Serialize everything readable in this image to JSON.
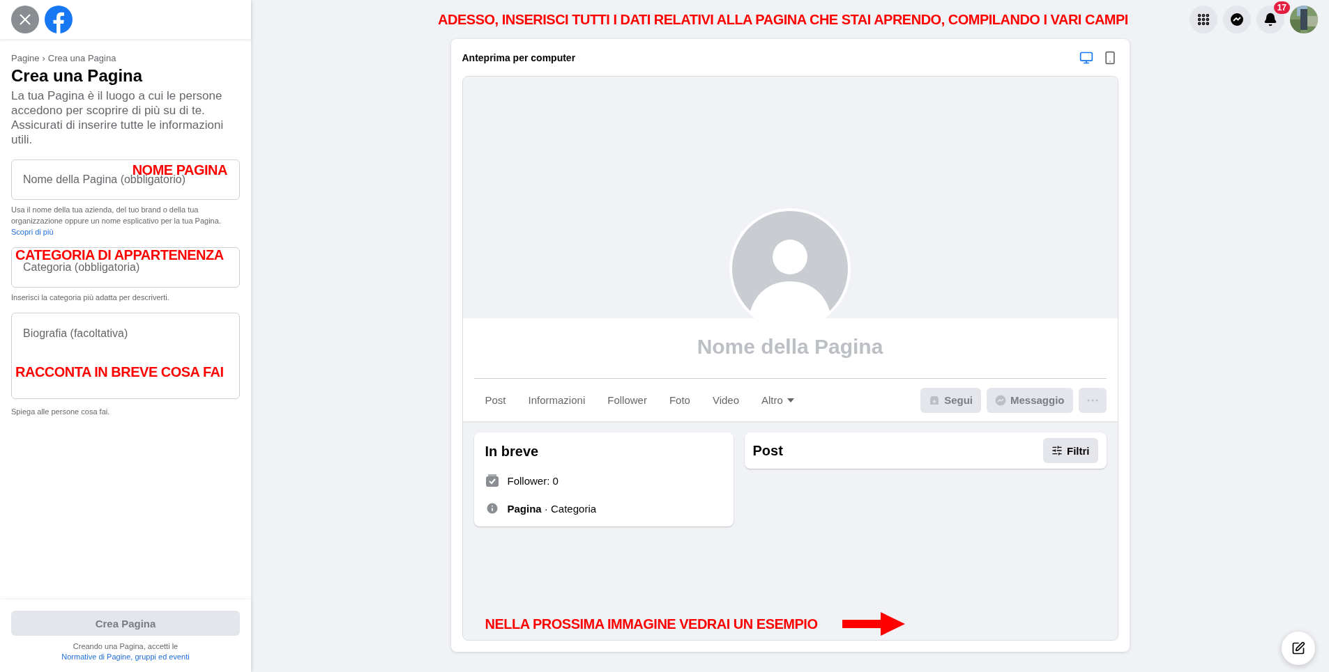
{
  "topbar": {
    "annotation": "ADESSO, INSERISCI TUTTI I DATI RELATIVI ALLA PAGINA CHE STAI APRENDO, COMPILANDO I VARI CAMPI",
    "notification_count": "17"
  },
  "sidebar": {
    "breadcrumb": [
      "Pagine",
      "Crea una Pagina"
    ],
    "breadcrumb_separator": "›",
    "title": "Crea una Pagina",
    "description": "La tua Pagina è il luogo a cui le persone accedono per scoprire di più su di te. Assicurati di inserire tutte le informazioni utili.",
    "fields": [
      {
        "kind": "input",
        "placeholder": "Nome della Pagina (obbligatorio)",
        "help": "Usa il nome della tua azienda, del tuo brand o della tua organizzazione oppure un nome esplicativo per la tua Pagina.",
        "link": "Scopri di più",
        "annotation": "NOME PAGINA"
      },
      {
        "kind": "input",
        "placeholder": "Categoria (obbligatoria)",
        "help": "Inserisci la categoria più adatta per descriverti.",
        "annotation": "CATEGORIA DI APPARTENENZA"
      },
      {
        "kind": "textarea",
        "placeholder": "Biografia (facoltativa)",
        "help": "Spiega alle persone cosa fai.",
        "annotation": "RACCONTA IN BREVE COSA FAI"
      }
    ],
    "create_button": {
      "label": "Crea Pagina",
      "disabled": true
    },
    "terms": {
      "text": "Creando una Pagina, accetti le",
      "link": "Normative di Pagine, gruppi ed eventi"
    }
  },
  "preview": {
    "title": "Anteprima per computer",
    "view_modes": [
      {
        "kind": "desktop",
        "selected": true
      },
      {
        "kind": "mobile",
        "selected": false
      }
    ],
    "page_name": "Nome della Pagina",
    "tabs": [
      {
        "label": "Post",
        "kind": "plain"
      },
      {
        "label": "Informazioni",
        "kind": "plain"
      },
      {
        "label": "Follower",
        "kind": "plain"
      },
      {
        "label": "Foto",
        "kind": "plain"
      },
      {
        "label": "Video",
        "kind": "plain"
      },
      {
        "label": "Altro",
        "kind": "dropdown"
      }
    ],
    "actions": [
      {
        "kind": "follow",
        "label": "Segui",
        "disabled": true
      },
      {
        "kind": "message",
        "label": "Messaggio",
        "disabled": true
      },
      {
        "kind": "more",
        "disabled": true
      }
    ],
    "intro": {
      "title": "In breve",
      "items": [
        {
          "kind": "followers",
          "text": "Follower: 0"
        },
        {
          "kind": "info",
          "text": "**Pagina** · Categoria"
        }
      ]
    },
    "posts": {
      "title": "Post",
      "filter_button": "Filtri"
    },
    "annotation": "NELLA PROSSIMA IMMAGINE VEDRAI UN ESEMPIO"
  }
}
